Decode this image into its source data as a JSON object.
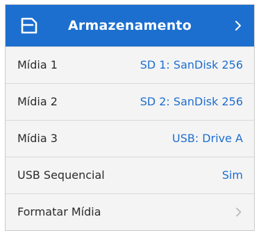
{
  "header": {
    "title": "Armazenamento",
    "icon": "storage-folder-icon",
    "chevron_icon": "chevron-right-icon"
  },
  "rows": [
    {
      "label": "Mídia 1",
      "value": "SD 1: SanDisk 256"
    },
    {
      "label": "Mídia 2",
      "value": "SD 2: SanDisk 256"
    },
    {
      "label": "Mídia 3",
      "value": "USB: Drive A"
    },
    {
      "label": "USB Sequencial",
      "value": "Sim"
    },
    {
      "label": "Formatar Mídia",
      "icon": "chevron-right-icon"
    }
  ],
  "colors": {
    "accent": "#1c6fcf",
    "value_text": "#1d6ecf",
    "label_text": "#2a2a2a",
    "row_background": "#f4f4f4",
    "divider": "#d8d8d8"
  }
}
